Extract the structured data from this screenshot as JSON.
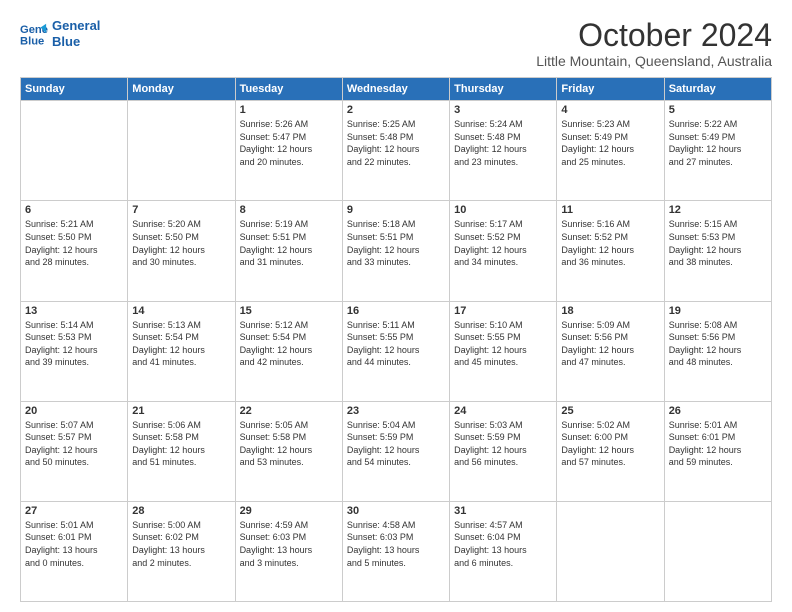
{
  "header": {
    "logo_line1": "General",
    "logo_line2": "Blue",
    "month": "October 2024",
    "location": "Little Mountain, Queensland, Australia"
  },
  "weekdays": [
    "Sunday",
    "Monday",
    "Tuesday",
    "Wednesday",
    "Thursday",
    "Friday",
    "Saturday"
  ],
  "weeks": [
    [
      {
        "day": "",
        "info": ""
      },
      {
        "day": "",
        "info": ""
      },
      {
        "day": "1",
        "info": "Sunrise: 5:26 AM\nSunset: 5:47 PM\nDaylight: 12 hours\nand 20 minutes."
      },
      {
        "day": "2",
        "info": "Sunrise: 5:25 AM\nSunset: 5:48 PM\nDaylight: 12 hours\nand 22 minutes."
      },
      {
        "day": "3",
        "info": "Sunrise: 5:24 AM\nSunset: 5:48 PM\nDaylight: 12 hours\nand 23 minutes."
      },
      {
        "day": "4",
        "info": "Sunrise: 5:23 AM\nSunset: 5:49 PM\nDaylight: 12 hours\nand 25 minutes."
      },
      {
        "day": "5",
        "info": "Sunrise: 5:22 AM\nSunset: 5:49 PM\nDaylight: 12 hours\nand 27 minutes."
      }
    ],
    [
      {
        "day": "6",
        "info": "Sunrise: 5:21 AM\nSunset: 5:50 PM\nDaylight: 12 hours\nand 28 minutes."
      },
      {
        "day": "7",
        "info": "Sunrise: 5:20 AM\nSunset: 5:50 PM\nDaylight: 12 hours\nand 30 minutes."
      },
      {
        "day": "8",
        "info": "Sunrise: 5:19 AM\nSunset: 5:51 PM\nDaylight: 12 hours\nand 31 minutes."
      },
      {
        "day": "9",
        "info": "Sunrise: 5:18 AM\nSunset: 5:51 PM\nDaylight: 12 hours\nand 33 minutes."
      },
      {
        "day": "10",
        "info": "Sunrise: 5:17 AM\nSunset: 5:52 PM\nDaylight: 12 hours\nand 34 minutes."
      },
      {
        "day": "11",
        "info": "Sunrise: 5:16 AM\nSunset: 5:52 PM\nDaylight: 12 hours\nand 36 minutes."
      },
      {
        "day": "12",
        "info": "Sunrise: 5:15 AM\nSunset: 5:53 PM\nDaylight: 12 hours\nand 38 minutes."
      }
    ],
    [
      {
        "day": "13",
        "info": "Sunrise: 5:14 AM\nSunset: 5:53 PM\nDaylight: 12 hours\nand 39 minutes."
      },
      {
        "day": "14",
        "info": "Sunrise: 5:13 AM\nSunset: 5:54 PM\nDaylight: 12 hours\nand 41 minutes."
      },
      {
        "day": "15",
        "info": "Sunrise: 5:12 AM\nSunset: 5:54 PM\nDaylight: 12 hours\nand 42 minutes."
      },
      {
        "day": "16",
        "info": "Sunrise: 5:11 AM\nSunset: 5:55 PM\nDaylight: 12 hours\nand 44 minutes."
      },
      {
        "day": "17",
        "info": "Sunrise: 5:10 AM\nSunset: 5:55 PM\nDaylight: 12 hours\nand 45 minutes."
      },
      {
        "day": "18",
        "info": "Sunrise: 5:09 AM\nSunset: 5:56 PM\nDaylight: 12 hours\nand 47 minutes."
      },
      {
        "day": "19",
        "info": "Sunrise: 5:08 AM\nSunset: 5:56 PM\nDaylight: 12 hours\nand 48 minutes."
      }
    ],
    [
      {
        "day": "20",
        "info": "Sunrise: 5:07 AM\nSunset: 5:57 PM\nDaylight: 12 hours\nand 50 minutes."
      },
      {
        "day": "21",
        "info": "Sunrise: 5:06 AM\nSunset: 5:58 PM\nDaylight: 12 hours\nand 51 minutes."
      },
      {
        "day": "22",
        "info": "Sunrise: 5:05 AM\nSunset: 5:58 PM\nDaylight: 12 hours\nand 53 minutes."
      },
      {
        "day": "23",
        "info": "Sunrise: 5:04 AM\nSunset: 5:59 PM\nDaylight: 12 hours\nand 54 minutes."
      },
      {
        "day": "24",
        "info": "Sunrise: 5:03 AM\nSunset: 5:59 PM\nDaylight: 12 hours\nand 56 minutes."
      },
      {
        "day": "25",
        "info": "Sunrise: 5:02 AM\nSunset: 6:00 PM\nDaylight: 12 hours\nand 57 minutes."
      },
      {
        "day": "26",
        "info": "Sunrise: 5:01 AM\nSunset: 6:01 PM\nDaylight: 12 hours\nand 59 minutes."
      }
    ],
    [
      {
        "day": "27",
        "info": "Sunrise: 5:01 AM\nSunset: 6:01 PM\nDaylight: 13 hours\nand 0 minutes."
      },
      {
        "day": "28",
        "info": "Sunrise: 5:00 AM\nSunset: 6:02 PM\nDaylight: 13 hours\nand 2 minutes."
      },
      {
        "day": "29",
        "info": "Sunrise: 4:59 AM\nSunset: 6:03 PM\nDaylight: 13 hours\nand 3 minutes."
      },
      {
        "day": "30",
        "info": "Sunrise: 4:58 AM\nSunset: 6:03 PM\nDaylight: 13 hours\nand 5 minutes."
      },
      {
        "day": "31",
        "info": "Sunrise: 4:57 AM\nSunset: 6:04 PM\nDaylight: 13 hours\nand 6 minutes."
      },
      {
        "day": "",
        "info": ""
      },
      {
        "day": "",
        "info": ""
      }
    ]
  ]
}
